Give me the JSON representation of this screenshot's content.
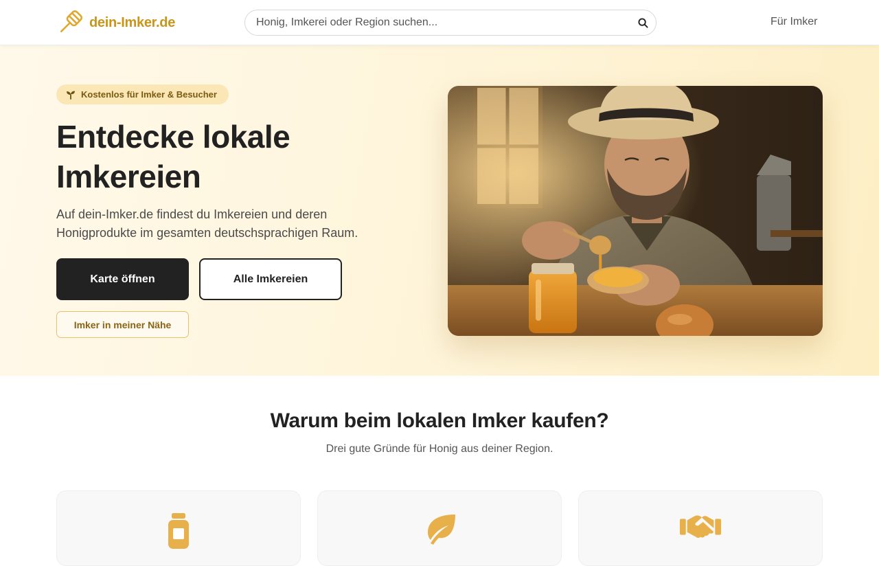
{
  "header": {
    "logo_text": "dein-Imker.de",
    "logo_icon": "honey-dipper-icon",
    "search_placeholder": "Honig, Imkerei oder Region suchen...",
    "search_icon": "search-icon",
    "nav_label": "Für Imker"
  },
  "hero": {
    "badge_icon": "sprout-icon",
    "badge_text": "Kostenlos für Imker & Besucher",
    "title_line1": "Entdecke lokale",
    "title_line2": "Imkereien",
    "description": "Auf dein-Imker.de findest du Imkereien und deren Honigprodukte im gesamten deutschsprachigen Raum.",
    "btn_primary": "Karte öffnen",
    "btn_secondary": "Alle Imkereien",
    "btn_nearby": "Imker in meiner Nähe",
    "image": "beekeeper-honey-photo"
  },
  "why": {
    "title": "Warum beim lokalen Imker kaufen?",
    "subtitle": "Drei gute Gründe für Honig aus deiner Region.",
    "cards": [
      {
        "icon": "honey-jar-icon"
      },
      {
        "icon": "leaf-icon"
      },
      {
        "icon": "handshake-icon"
      }
    ]
  },
  "colors": {
    "brand": "#c9961a",
    "hero_bg": "#fef4d8",
    "dark": "#222222",
    "icon_accent": "#e8b04a"
  }
}
